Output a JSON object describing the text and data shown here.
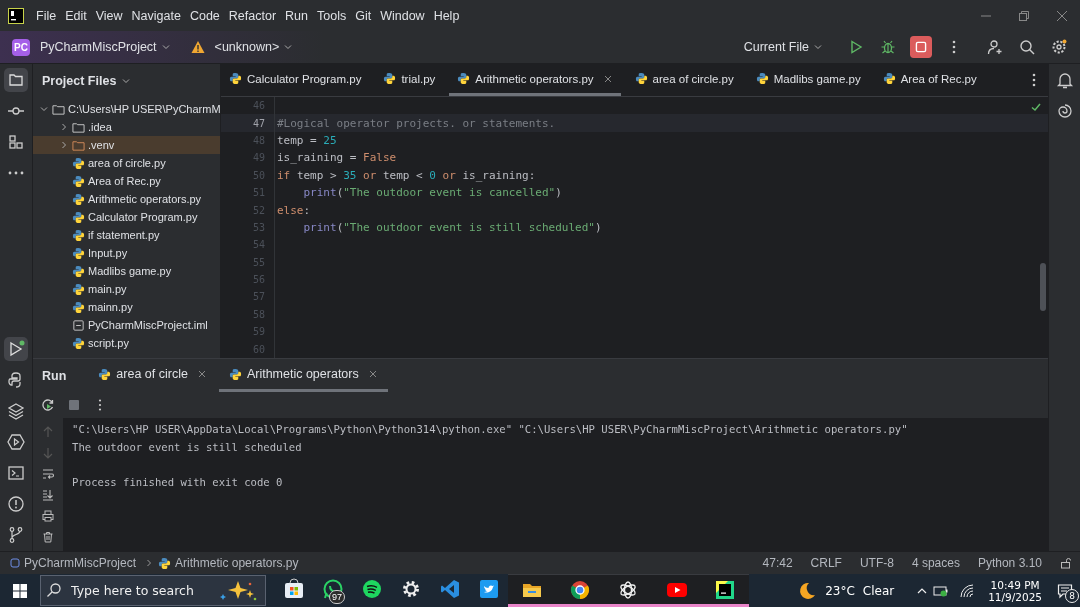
{
  "menu": [
    "File",
    "Edit",
    "View",
    "Navigate",
    "Code",
    "Refactor",
    "Run",
    "Tools",
    "Git",
    "Window",
    "Help"
  ],
  "toolbar": {
    "project_badge": "PC",
    "project": "PyCharmMiscProject",
    "branch": "<unknown>",
    "run_config": "Current File"
  },
  "project_panel": {
    "title": "Project Files",
    "tree": {
      "label": "C:\\Users\\HP USER\\PyCharmM",
      "expanded": true,
      "children": [
        {
          "label": ".idea",
          "kind": "folder",
          "expanded": false,
          "selected": false
        },
        {
          "label": ".venv",
          "kind": "folder",
          "expanded": false,
          "selected": true
        },
        {
          "label": "area of circle.py",
          "kind": "python",
          "selected": false
        },
        {
          "label": "Area of Rec.py",
          "kind": "python",
          "selected": false
        },
        {
          "label": "Arithmetic operators.py",
          "kind": "python",
          "selected": false
        },
        {
          "label": "Calculator Program.py",
          "kind": "python",
          "selected": false
        },
        {
          "label": "if statement.py",
          "kind": "python",
          "selected": false
        },
        {
          "label": "Input.py",
          "kind": "python",
          "selected": false
        },
        {
          "label": "Madlibs game.py",
          "kind": "python",
          "selected": false
        },
        {
          "label": "main.py",
          "kind": "python",
          "selected": false
        },
        {
          "label": "mainn.py",
          "kind": "python",
          "selected": false
        },
        {
          "label": "PyCharmMiscProject.iml",
          "kind": "file",
          "selected": false
        },
        {
          "label": "script.py",
          "kind": "python",
          "selected": false
        }
      ]
    }
  },
  "editor_tabs": [
    {
      "label": "Calculator Program.py",
      "selected": false
    },
    {
      "label": "trial.py",
      "selected": false
    },
    {
      "label": "Arithmetic operators.py",
      "selected": true
    },
    {
      "label": "area of circle.py",
      "selected": false
    },
    {
      "label": "Madlibs game.py",
      "selected": false
    },
    {
      "label": "Area of Rec.py",
      "selected": false
    }
  ],
  "code_lines": [
    {
      "number": "46",
      "current": false
    },
    {
      "number": "47",
      "current": true,
      "indented": false,
      "tokens": [
        {
          "kind": "comment",
          "text": "#Logical operator projects. or statements."
        }
      ]
    },
    {
      "number": "48",
      "current": false,
      "indented": false,
      "tokens": [
        {
          "kind": "plain",
          "text": "temp = "
        },
        {
          "kind": "number",
          "text": "25"
        }
      ]
    },
    {
      "number": "49",
      "current": false,
      "indented": false,
      "tokens": [
        {
          "kind": "plain",
          "text": "is_raining = "
        },
        {
          "kind": "keyword",
          "text": "False"
        }
      ]
    },
    {
      "number": "50",
      "current": false,
      "indented": false,
      "tokens": [
        {
          "kind": "keyword",
          "text": "if "
        },
        {
          "kind": "plain",
          "text": "temp > "
        },
        {
          "kind": "number",
          "text": "35"
        },
        {
          "kind": "keyword",
          "text": " or "
        },
        {
          "kind": "plain",
          "text": "temp < "
        },
        {
          "kind": "number",
          "text": "0"
        },
        {
          "kind": "keyword",
          "text": " or "
        },
        {
          "kind": "plain",
          "text": "is_raining:"
        }
      ]
    },
    {
      "number": "51",
      "current": false,
      "indented": true,
      "tokens": [
        {
          "kind": "builtin",
          "text": "print"
        },
        {
          "kind": "plain",
          "text": "("
        },
        {
          "kind": "string",
          "text": "\"The outdoor event is cancelled\""
        },
        {
          "kind": "plain",
          "text": ")"
        }
      ]
    },
    {
      "number": "52",
      "current": false,
      "indented": false,
      "tokens": [
        {
          "kind": "keyword",
          "text": "else"
        },
        {
          "kind": "plain",
          "text": ":"
        }
      ]
    },
    {
      "number": "53",
      "current": false,
      "indented": true,
      "tokens": [
        {
          "kind": "builtin",
          "text": "print"
        },
        {
          "kind": "plain",
          "text": "("
        },
        {
          "kind": "string",
          "text": "\"The outdoor event is still scheduled\""
        },
        {
          "kind": "plain",
          "text": ")"
        }
      ]
    },
    {
      "number": "54",
      "current": false
    },
    {
      "number": "55",
      "current": false
    },
    {
      "number": "56",
      "current": false
    },
    {
      "number": "57",
      "current": false
    },
    {
      "number": "58",
      "current": false
    },
    {
      "number": "59",
      "current": false
    },
    {
      "number": "60",
      "current": false
    }
  ],
  "run_panel": {
    "title": "Run",
    "tabs": [
      {
        "label": "area of circle",
        "selected": false
      },
      {
        "label": "Arithmetic operators",
        "selected": true
      }
    ],
    "console": [
      {
        "text": "\"C:\\Users\\HP USER\\AppData\\Local\\Programs\\Python\\Python314\\python.exe\" \"C:\\Users\\HP USER\\PyCharmMiscProject\\Arithmetic operators.py\"",
        "blank_before": false
      },
      {
        "text": "The outdoor event is still scheduled",
        "blank_before": false
      },
      {
        "text": "Process finished with exit code 0",
        "blank_before": true
      }
    ]
  },
  "status_bar": {
    "breadcrumbs": [
      "PyCharmMiscProject",
      "Arithmetic operators.py"
    ],
    "items": [
      "47:42",
      "CRLF",
      "UTF-8",
      "4 spaces",
      "Python 3.10"
    ]
  },
  "taskbar": {
    "search_placeholder": "Type here to search",
    "apps": [
      {
        "kind": "store",
        "running": false
      },
      {
        "kind": "whatsapp",
        "running": false,
        "badge": "97"
      },
      {
        "kind": "spotify",
        "running": false
      },
      {
        "kind": "settings",
        "running": false
      },
      {
        "kind": "vscode",
        "running": false
      },
      {
        "kind": "twitter",
        "running": false
      },
      {
        "kind": "files",
        "running": true
      },
      {
        "kind": "chrome",
        "running": true
      },
      {
        "kind": "chatgpt",
        "running": true
      },
      {
        "kind": "youtube",
        "running": true
      },
      {
        "kind": "pycharm",
        "running": true
      }
    ],
    "weather": {
      "temperature": "23°C",
      "condition": "Clear"
    },
    "time": "10:49 PM",
    "date": "11/9/2025",
    "notifications": "8"
  }
}
